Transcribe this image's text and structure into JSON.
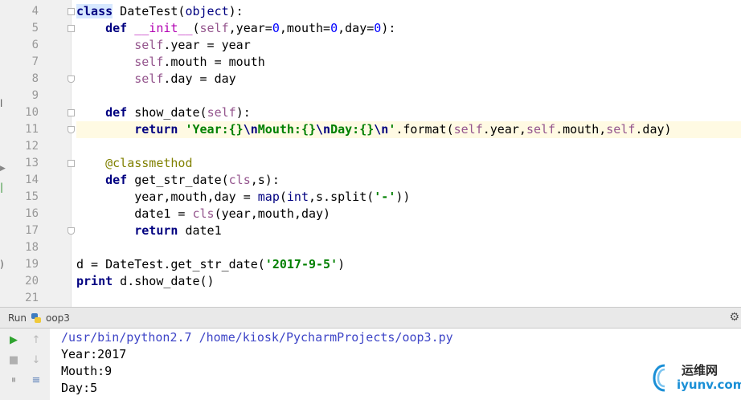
{
  "editor": {
    "line_numbers": [
      "4",
      "5",
      "6",
      "7",
      "8",
      "9",
      "10",
      "11",
      "12",
      "13",
      "14",
      "15",
      "16",
      "17",
      "18",
      "19",
      "20",
      "21"
    ],
    "code": {
      "l4": {
        "kw": "class",
        "rest": " DateTest(",
        "builtin": "object",
        "end": "):"
      },
      "l5": {
        "kw": "def",
        "magic": "__init__",
        "p1": "(",
        "self": "self",
        "p2": ",year=",
        "n1": "0",
        "p3": ",mouth=",
        "n2": "0",
        "p4": ",day=",
        "n3": "0",
        "p5": "):"
      },
      "l6": {
        "self": "self",
        "rest": ".year = year"
      },
      "l7": {
        "self": "self",
        "rest": ".mouth = mouth"
      },
      "l8": {
        "self": "self",
        "rest": ".day = day"
      },
      "l10": {
        "kw": "def",
        "rest": " show_date(",
        "self": "self",
        "end": "):"
      },
      "l11": {
        "kw": "return",
        "s1": "'Year:{}",
        "e1": "\\n",
        "s2": "Mouth:{}",
        "e2": "\\n",
        "s3": "Day:{}",
        "e3": "\\n",
        "s4": "'",
        "r1": ".format(",
        "self1": "self",
        "r2": ".year,",
        "self2": "self",
        "r3": ".mouth,",
        "self3": "self",
        "r4": ".day)"
      },
      "l13": {
        "dec": "@classmethod"
      },
      "l14": {
        "kw": "def",
        "rest": " get_str_date(",
        "self": "cls",
        "end": ",s):"
      },
      "l15": {
        "a": "year,mouth,day = ",
        "b1": "map",
        "b2": "(",
        "b3": "int",
        "b4": ",s.split(",
        "str": "'-'",
        "b5": "))"
      },
      "l16": {
        "a": "date1 = ",
        "self": "cls",
        "b": "(year,mouth,day)"
      },
      "l17": {
        "kw": "return",
        "rest": " date1"
      },
      "l19": {
        "a": "d = DateTest.get_str_date(",
        "str": "'2017-9-5'",
        "b": ")"
      },
      "l20": {
        "kw": "print",
        "rest": " d.show_date()"
      }
    }
  },
  "run_panel": {
    "label": "Run",
    "config_name": "oop3",
    "output": [
      "/usr/bin/python2.7 /home/kiosk/PycharmProjects/oop3.py",
      "Year:2017",
      "Mouth:9",
      "Day:5"
    ]
  },
  "watermark": {
    "top_text": "运维网",
    "bottom_text": "iyunv.com"
  },
  "colors": {
    "keyword": "#000080",
    "self": "#94558d",
    "string": "#008000",
    "number": "#0000ff",
    "decorator": "#808000",
    "console_cmd": "#3e45c7"
  }
}
